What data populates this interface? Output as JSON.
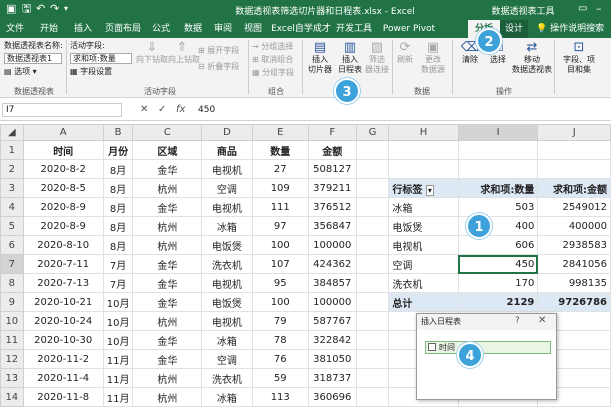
{
  "title_bar": {
    "file_title": "数据透视表筛选切片器和日程表.xlsx - Excel",
    "context_title": "数据透视表工具"
  },
  "tabs": [
    "文件",
    "开始",
    "插入",
    "页面布局",
    "公式",
    "数据",
    "审阅",
    "视图",
    "Excel自学成才",
    "开发工具",
    "Power Pivot",
    "分析",
    "设计"
  ],
  "tell_me": "操作说明搜索",
  "ribbon": {
    "pt_name_label": "数据透视表名称:",
    "pt_name_value": "数据透视表1",
    "options": "选项",
    "group_pt": "数据透视表",
    "active_field_label": "活动字段:",
    "active_field_value": "求和项:数量",
    "field_settings": "字段设置",
    "drill_down": "向下钻取",
    "drill_up": "向上钻取",
    "expand_field": "展开字段",
    "collapse_field": "折叠字段",
    "group_active": "活动字段",
    "group_selection": "分组选择",
    "ungroup": "取消组合",
    "group_field": "分组字段",
    "group_group": "组合",
    "insert_slicer": "插入\n切片器",
    "insert_timeline": "插入\n日程表",
    "filter_conn": "筛选\n器连接",
    "group_filter": "筛选",
    "refresh": "刷新",
    "change_source": "更改\n数据源",
    "group_data": "数据",
    "clear": "清除",
    "select": "选择",
    "move_pt": "移动\n数据透视表",
    "group_actions": "操作",
    "fields_items": "字段、项\n目和集"
  },
  "formula_bar": {
    "name_box": "I7",
    "cancel": "✕",
    "enter": "✓",
    "fx": "fx",
    "value": "450"
  },
  "columns": [
    "A",
    "B",
    "C",
    "D",
    "E",
    "F",
    "G",
    "H",
    "I",
    "J"
  ],
  "headers": [
    "时间",
    "月份",
    "区域",
    "商品",
    "数量",
    "金额"
  ],
  "rows": [
    [
      "2020-8-2",
      "8月",
      "金华",
      "电视机",
      "27",
      "508127"
    ],
    [
      "2020-8-5",
      "8月",
      "杭州",
      "空调",
      "109",
      "379211"
    ],
    [
      "2020-8-9",
      "8月",
      "金华",
      "电视机",
      "111",
      "376512"
    ],
    [
      "2020-8-9",
      "8月",
      "杭州",
      "冰箱",
      "97",
      "356847"
    ],
    [
      "2020-8-10",
      "8月",
      "杭州",
      "电饭煲",
      "100",
      "100000"
    ],
    [
      "2020-7-11",
      "7月",
      "金华",
      "洗衣机",
      "107",
      "424362"
    ],
    [
      "2020-7-13",
      "7月",
      "金华",
      "电视机",
      "95",
      "384857"
    ],
    [
      "2020-10-21",
      "10月",
      "金华",
      "电饭煲",
      "100",
      "100000"
    ],
    [
      "2020-10-24",
      "10月",
      "杭州",
      "电视机",
      "79",
      "587767"
    ],
    [
      "2020-10-30",
      "10月",
      "金华",
      "冰箱",
      "78",
      "322842"
    ],
    [
      "2020-11-2",
      "11月",
      "金华",
      "空调",
      "76",
      "381050"
    ],
    [
      "2020-11-4",
      "11月",
      "杭州",
      "洗衣机",
      "59",
      "318737"
    ],
    [
      "2020-11-8",
      "11月",
      "杭州",
      "冰箱",
      "113",
      "360696"
    ]
  ],
  "pivot": {
    "row_label": "行标签",
    "col_qty": "求和项:数量",
    "col_amt": "求和项:金额",
    "rows": [
      [
        "冰箱",
        "503",
        "2549012"
      ],
      [
        "电饭煲",
        "400",
        "400000"
      ],
      [
        "电视机",
        "606",
        "2938583"
      ],
      [
        "空调",
        "450",
        "2841056"
      ],
      [
        "洗衣机",
        "170",
        "998135"
      ]
    ],
    "total_label": "总计",
    "total_qty": "2129",
    "total_amt": "9726786"
  },
  "timeline_dialog": {
    "title": "插入日程表",
    "help": "?",
    "close": "✕",
    "field": "时间"
  },
  "badges": [
    "1",
    "2",
    "3",
    "4"
  ],
  "colors": {
    "excel_green": "#217346",
    "badge_blue": "#3ea2da",
    "pivot_header": "#dde8f5"
  }
}
